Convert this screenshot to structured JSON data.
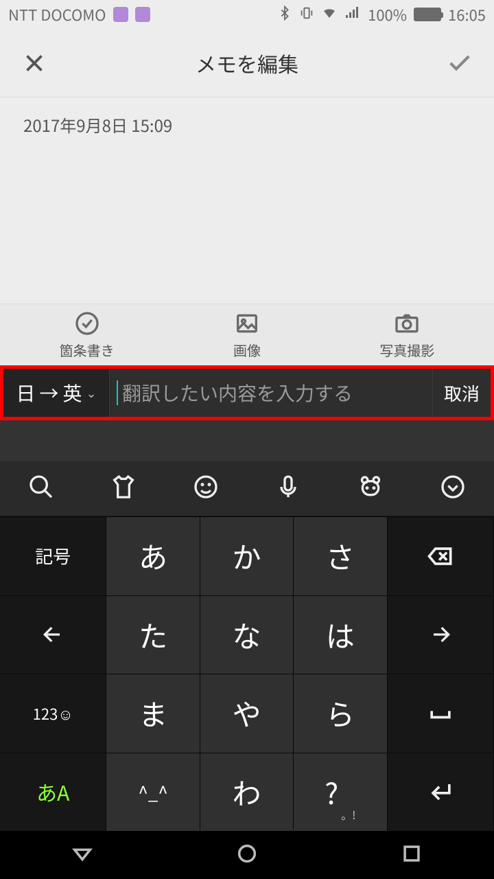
{
  "status": {
    "carrier": "NTT DOCOMO",
    "battery_pct": "100%",
    "time": "16:05"
  },
  "header": {
    "title": "メモを編集"
  },
  "memo": {
    "date": "2017年9月8日 15:09"
  },
  "tools": {
    "bullet": "箇条書き",
    "image": "画像",
    "camera": "写真撮影"
  },
  "translate": {
    "lang_from": "日",
    "arrow": "→",
    "lang_to": "英",
    "placeholder": "翻訳したい内容を入力する",
    "cancel": "取消"
  },
  "keyboard": {
    "rows": [
      [
        "記号",
        "あ",
        "か",
        "さ",
        "⌫"
      ],
      [
        "←",
        "た",
        "な",
        "は",
        "→"
      ],
      [
        "123☺",
        "ま",
        "や",
        "ら",
        "␣"
      ],
      [
        "あA",
        "^_^",
        "わ",
        "? !",
        "⏎"
      ]
    ],
    "key_symbol": "記号",
    "key_a": "あ",
    "key_ka": "か",
    "key_sa": "さ",
    "key_ta": "た",
    "key_na": "な",
    "key_ha": "は",
    "key_ma": "ま",
    "key_ya": "や",
    "key_ra": "ら",
    "key_wa": "わ",
    "key_123": "123☺",
    "key_mode": "あA",
    "key_face": "^_^",
    "key_punct_main": "?",
    "key_punct_sub": "。!"
  }
}
